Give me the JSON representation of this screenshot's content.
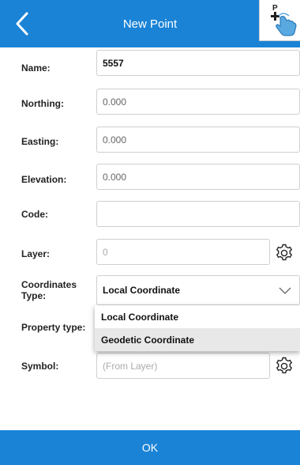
{
  "header": {
    "title": "New Point",
    "back_icon": "chevron-left-icon",
    "add_point_icon": "add-point-hand-icon",
    "add_point_badge": "P"
  },
  "form": {
    "name": {
      "label": "Name:",
      "value": "5557"
    },
    "northing": {
      "label": "Northing:",
      "value": "0.000"
    },
    "easting": {
      "label": "Easting:",
      "value": "0.000"
    },
    "elevation": {
      "label": "Elevation:",
      "value": "0.000"
    },
    "code": {
      "label": "Code:",
      "value": ""
    },
    "layer": {
      "label": "Layer:",
      "placeholder": "0"
    },
    "coordinates_type": {
      "label": "Coordinates Type:",
      "selected": "Local Coordinate",
      "options": [
        "Local Coordinate",
        "Geodetic Coordinate"
      ]
    },
    "property_type": {
      "label": "Property type:"
    },
    "symbol": {
      "label": "Symbol:",
      "placeholder": "(From Layer)"
    }
  },
  "footer": {
    "ok_label": "OK"
  },
  "colors": {
    "accent": "#1a83d6",
    "text": "#222222",
    "border": "#cfcfcf"
  }
}
